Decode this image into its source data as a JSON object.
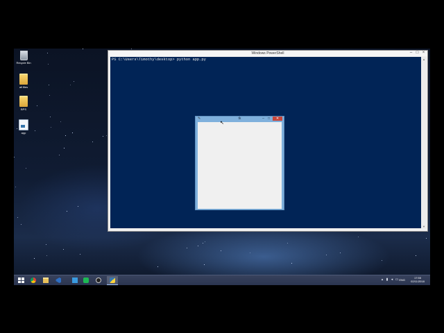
{
  "desktop": {
    "icons": [
      {
        "label": "Recycle Bin",
        "icon": "recycle-bin-icon"
      },
      {
        "label": "all files",
        "icon": "folder-icon"
      },
      {
        "label": "BPS",
        "icon": "folder-icon"
      },
      {
        "label": "app",
        "icon": "python-file-icon"
      }
    ]
  },
  "powershell": {
    "title": "Windows PowerShell",
    "prompt": "PS C:\\Users\\Timothy\\desktop> python app.py",
    "background": "#012456"
  },
  "tk_window": {
    "title": "tk",
    "close_color": "#c7463b"
  },
  "taskbar": {
    "apps": [
      "start-icon",
      "chrome-icon",
      "file-explorer-icon",
      "visual-studio-icon",
      "task-manager-icon",
      "spotify-icon",
      "obs-icon",
      "python-icon"
    ],
    "language": "ENG",
    "time": "17:55",
    "date": "02/11/2018"
  }
}
